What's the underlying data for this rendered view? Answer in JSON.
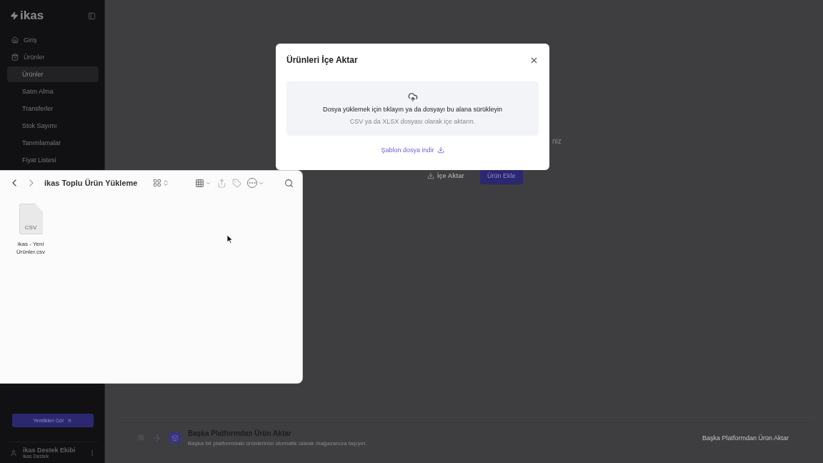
{
  "sidebar": {
    "logo": "ikas",
    "items": [
      {
        "label": "Giriş"
      },
      {
        "label": "Ürünler",
        "children": [
          {
            "label": "Ürünler",
            "selected": true
          },
          {
            "label": "Satın Alma",
            "selected": false
          },
          {
            "label": "Transferler",
            "selected": false
          },
          {
            "label": "Stok Sayımı",
            "selected": false
          },
          {
            "label": "Tanımlamalar",
            "selected": false
          },
          {
            "label": "Fiyat Listesi",
            "selected": false
          }
        ]
      }
    ],
    "news_button": "Yenilikleri Gör",
    "user": {
      "name": "ikas Destek Ekibi",
      "role": "ikas Destek"
    }
  },
  "main": {
    "hidden_text_tail": "niz",
    "import_button": "İçe Aktar",
    "add_button": "Ürün Ekle",
    "platform_card": {
      "title": "Başka Platformdan Ürün Aktar",
      "description": "Başka bir platformdaki ürünlerinizi otomatik olarak mağazanıza taşıyın.",
      "action": "Başka Platformdan Ürün Aktar"
    }
  },
  "modal": {
    "title": "Ürünleri İçe Aktar",
    "drop_title": "Dosya yüklemek için tıklayın ya da dosyayı bu alana sürükleyin",
    "drop_hint": "CSV ya da XLSX dosyası olarak içe aktarın.",
    "template_link": "Şablon dosya indir"
  },
  "finder": {
    "title": "ikas Toplu Ürün Yükleme",
    "files": [
      {
        "badge": "CSV",
        "name": "ikas - Yeni Ürünler.csv"
      }
    ]
  }
}
